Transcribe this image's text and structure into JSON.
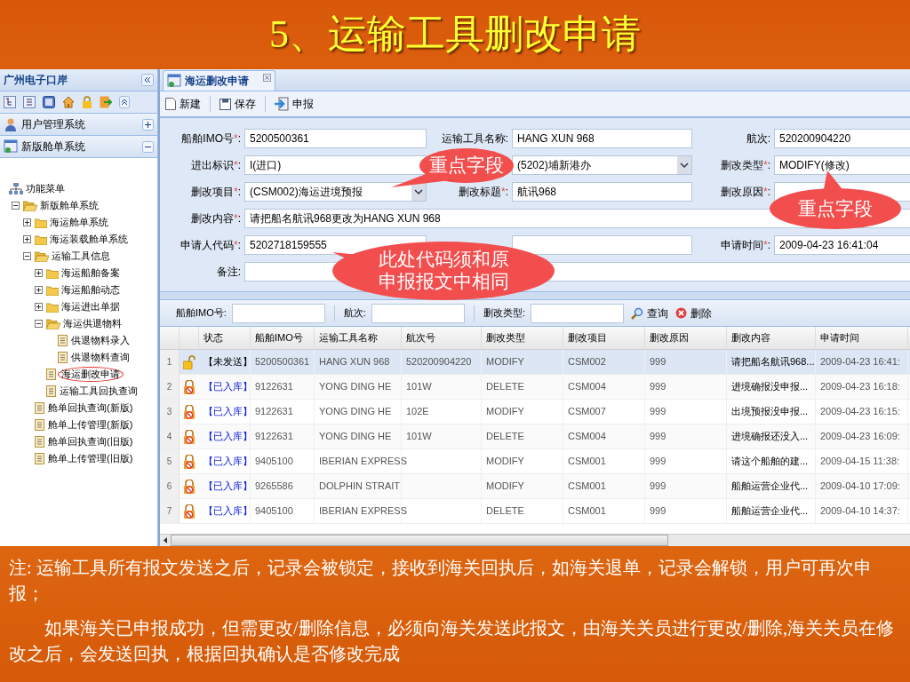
{
  "slide": {
    "title": "5、运输工具删改申请",
    "notes": [
      "注: 运输工具所有报文发送之后，记录会被锁定，接收到海关回执后，如海关退单，记录会解锁，用户可再次申报；",
      "如果海关已申报成功，但需更改/删除信息，必须向海关发送此报文，由海关关员进行更改/删除,海关关员在修改之后，会发送回执，根据回执确认是否修改完成"
    ]
  },
  "sidebar": {
    "title": "广州电子口岸",
    "sections": [
      {
        "label": "用户管理系统",
        "expanded": false
      },
      {
        "label": "新版舱单系统",
        "expanded": true
      }
    ],
    "tree": [
      {
        "label": "功能菜单",
        "kind": "root",
        "children": [
          {
            "label": "新版舱单系统",
            "kind": "folder",
            "expanded": true,
            "children": [
              {
                "label": "海运舱单系统",
                "kind": "folder",
                "expanded": false
              },
              {
                "label": "海运装载舱单系统",
                "kind": "folder",
                "expanded": false
              },
              {
                "label": "运输工具信息",
                "kind": "folder",
                "expanded": true,
                "children": [
                  {
                    "label": "海运船舶备案",
                    "kind": "folder",
                    "expanded": false
                  },
                  {
                    "label": "海运船舶动态",
                    "kind": "folder",
                    "expanded": false
                  },
                  {
                    "label": "海运进出单据",
                    "kind": "folder",
                    "expanded": false
                  },
                  {
                    "label": "海运供退物料",
                    "kind": "folder",
                    "expanded": true,
                    "children": [
                      {
                        "label": "供退物料录入",
                        "kind": "page",
                        "circled": false
                      },
                      {
                        "label": "供退物料查询",
                        "kind": "page",
                        "circled": false
                      }
                    ]
                  },
                  {
                    "label": "海运删改申请",
                    "kind": "page",
                    "circled": true
                  },
                  {
                    "label": "运输工具回执查询",
                    "kind": "page",
                    "circled": false
                  }
                ]
              },
              {
                "label": "舱单回执查询(新版)",
                "kind": "page",
                "circled": false
              },
              {
                "label": "舱单上传管理(新版)",
                "kind": "page",
                "circled": false
              },
              {
                "label": "舱单回执查询(旧版)",
                "kind": "page",
                "circled": false
              },
              {
                "label": "舱单上传管理(旧版)",
                "kind": "page",
                "circled": false
              }
            ]
          }
        ]
      }
    ]
  },
  "tab": {
    "label": "海运删改申请"
  },
  "toolbar": [
    {
      "kind": "new",
      "label": "新建"
    },
    {
      "kind": "save",
      "label": "保存"
    },
    {
      "kind": "submit",
      "label": "申报"
    }
  ],
  "form": [
    [
      {
        "kind": "text",
        "label": "船舶IMO号",
        "mark": "*",
        "colon": ":",
        "value": "5200500361"
      },
      {
        "kind": "text",
        "label": "运输工具名称",
        "colon": ":",
        "value": "HANG XUN 968"
      },
      {
        "kind": "text",
        "label": "航次",
        "colon": ":",
        "value": "520200904220"
      }
    ],
    [
      {
        "kind": "text",
        "label": "进出标识",
        "mark": "*",
        "colon": ":",
        "value": "I(进口)"
      },
      {
        "kind": "select",
        "value": "(5202)埔新港办"
      },
      {
        "kind": "text",
        "label": "删改类型",
        "mark": "*",
        "colon": ":",
        "value": "MODIFY(修改)"
      }
    ],
    [
      {
        "kind": "select",
        "label": "删改项目",
        "mark": "*",
        "colon": ":",
        "value": "(CSM002)海运进境预报"
      },
      {
        "kind": "text",
        "label": "删改标题",
        "mark": "*",
        "colon": ":",
        "value": "航讯968"
      },
      {
        "kind": "text",
        "label": "删改原因",
        "mark": "*",
        "colon": ":"
      }
    ],
    [
      {
        "kind": "wide",
        "label": "删改内容",
        "mark": "*",
        "colon": ":",
        "value": "请把船名航讯968更改为HANG XUN 968"
      }
    ],
    [
      {
        "kind": "text",
        "label": "申请人代码",
        "mark": "*",
        "colon": ":",
        "value": "5202718159555"
      },
      {
        "kind": "text"
      },
      {
        "kind": "text",
        "label": "申请时间",
        "mark": "*",
        "colon": ":",
        "value": "2009-04-23 16:41:04"
      }
    ],
    [
      {
        "kind": "wide",
        "label": "备注",
        "colon": ":"
      }
    ]
  ],
  "filter": {
    "fields": [
      {
        "label": "船舶IMO号:"
      },
      {
        "label": "航次:"
      },
      {
        "label": "删改类型:"
      }
    ],
    "actions": [
      {
        "kind": "search",
        "label": "查询"
      },
      {
        "kind": "delete",
        "label": "删除"
      }
    ]
  },
  "table": {
    "columns": [
      "状态",
      "船舶IMO号",
      "运输工具名称",
      "航次号",
      "删改类型",
      "删改项目",
      "删改原因",
      "删改内容",
      "申请时间"
    ],
    "rows": [
      {
        "index": "1",
        "locked": false,
        "selected": true,
        "cells": [
          "【未发送】",
          "5200500361",
          "HANG XUN 968",
          "520200904220",
          "MODIFY",
          "CSM002",
          "999",
          "请把船名航讯968...",
          "2009-04-23 16:41:"
        ]
      },
      {
        "index": "2",
        "locked": true,
        "selected": false,
        "cells": [
          "【已入库】",
          "9122631",
          "YONG DING HE",
          "101W",
          "DELETE",
          "CSM004",
          "999",
          "进境确报没申报...",
          "2009-04-23 16:18:"
        ]
      },
      {
        "index": "3",
        "locked": true,
        "selected": false,
        "cells": [
          "【已入库】",
          "9122631",
          "YONG DING HE",
          "102E",
          "MODIFY",
          "CSM007",
          "999",
          "出境预报没申报...",
          "2009-04-23 16:15:"
        ]
      },
      {
        "index": "4",
        "locked": true,
        "selected": false,
        "cells": [
          "【已入库】",
          "9122631",
          "YONG DING HE",
          "101W",
          "DELETE",
          "CSM004",
          "999",
          "进境确报还没入...",
          "2009-04-23 16:09:"
        ]
      },
      {
        "index": "5",
        "locked": true,
        "selected": false,
        "cells": [
          "【已入库】",
          "9405100",
          "IBERIAN EXPRESS",
          null,
          "MODIFY",
          "CSM001",
          "999",
          "请这个船舶的建...",
          "2009-04-15 11:38:"
        ]
      },
      {
        "index": "6",
        "locked": true,
        "selected": false,
        "cells": [
          "【已入库】",
          "9265586",
          "DOLPHIN STRAIT",
          null,
          "MODIFY",
          "CSM001",
          "999",
          "船舶运营企业代...",
          "2009-04-10 17:09:"
        ]
      },
      {
        "index": "7",
        "locked": true,
        "selected": false,
        "cells": [
          "【已入库】",
          "9405100",
          "IBERIAN EXPRESS",
          null,
          "DELETE",
          "CSM001",
          "999",
          "船舶运营企业代...",
          "2009-04-10 14:37:"
        ]
      }
    ]
  },
  "callouts": [
    {
      "text": "重点字段"
    },
    {
      "text": "重点字段"
    },
    {
      "text": "此处代码须和原申报报文中相同"
    }
  ]
}
